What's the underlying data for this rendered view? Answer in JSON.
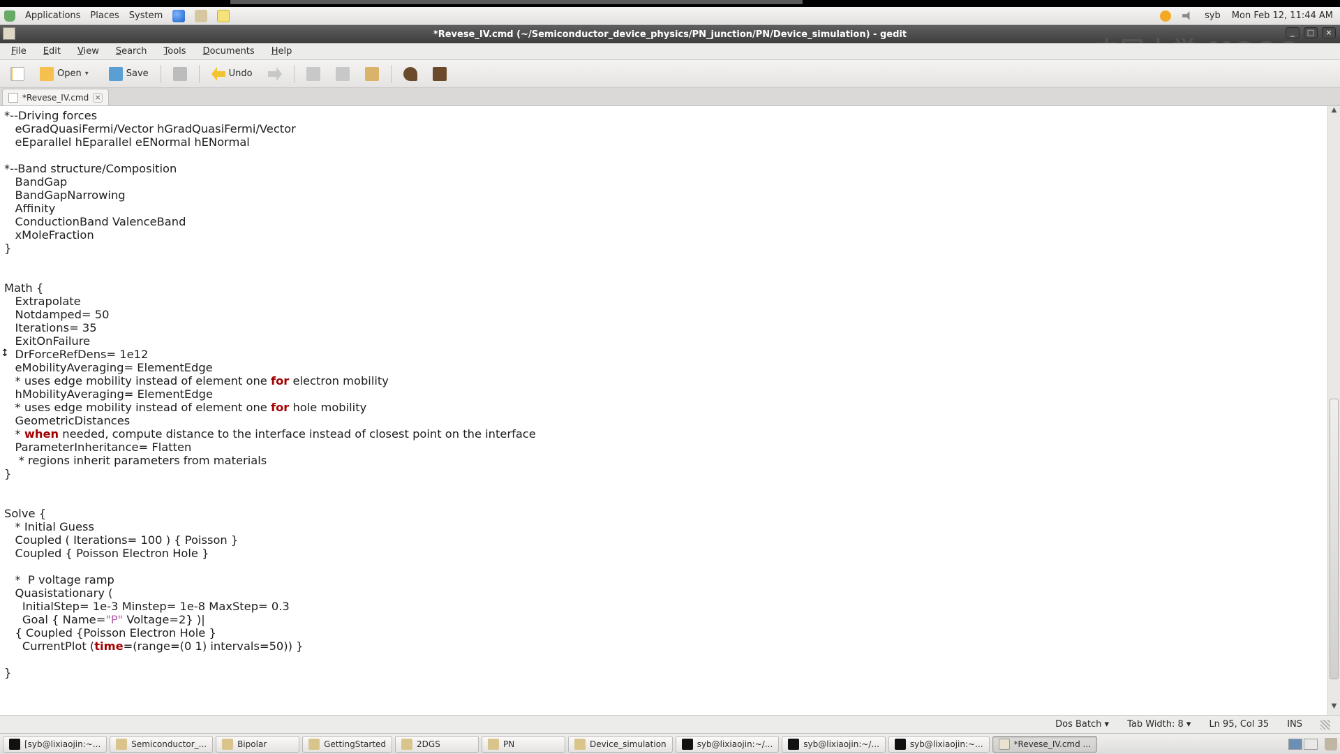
{
  "panel": {
    "menus": [
      "Applications",
      "Places",
      "System"
    ],
    "user": "syb",
    "clock": "Mon Feb 12, 11:44 AM"
  },
  "window": {
    "title": "*Revese_IV.cmd (~/Semiconductor_device_physics/PN_junction/PN/Device_simulation) - gedit",
    "min": "_",
    "max": "□",
    "close": "×"
  },
  "menubar": [
    "File",
    "Edit",
    "View",
    "Search",
    "Tools",
    "Documents",
    "Help"
  ],
  "toolbar": {
    "open": "Open",
    "save": "Save",
    "undo": "Undo"
  },
  "tab": {
    "name": "*Revese_IV.cmd",
    "close": "×"
  },
  "watermark": "中国大学 MOOC",
  "status": {
    "lang": "Dos Batch",
    "lang_arrow": "▾",
    "tabw": "Tab Width: 8",
    "tabw_arrow": "▾",
    "pos": "Ln 95, Col 35",
    "ins": "INS"
  },
  "taskbar": [
    {
      "label": "[syb@lixiaojin:~...",
      "icon": "term",
      "active": false
    },
    {
      "label": "Semiconductor_...",
      "icon": "fm",
      "active": false
    },
    {
      "label": "Bipolar",
      "icon": "fm",
      "active": false
    },
    {
      "label": "GettingStarted",
      "icon": "fm",
      "active": false
    },
    {
      "label": "2DGS",
      "icon": "fm",
      "active": false
    },
    {
      "label": "PN",
      "icon": "fm",
      "active": false
    },
    {
      "label": "Device_simulation",
      "icon": "fm",
      "active": false
    },
    {
      "label": "syb@lixiaojin:~/...",
      "icon": "term",
      "active": false
    },
    {
      "label": "syb@lixiaojin:~/...",
      "icon": "term",
      "active": false
    },
    {
      "label": "syb@lixiaojin:~...",
      "icon": "term",
      "active": false
    },
    {
      "label": "*Revese_IV.cmd ...",
      "icon": "gedit",
      "active": true
    }
  ],
  "code": {
    "l1": "*--Driving forces",
    "l2": "   eGradQuasiFermi/Vector hGradQuasiFermi/Vector",
    "l3": "   eEparallel hEparallel eENormal hENormal",
    "l4": "",
    "l5": "*--Band structure/Composition",
    "l6": "   BandGap",
    "l7": "   BandGapNarrowing",
    "l8": "   Affinity",
    "l9": "   ConductionBand ValenceBand",
    "l10": "   xMoleFraction",
    "l11": "}",
    "l12": "",
    "l13": "",
    "l14": "Math {",
    "l15": "   Extrapolate",
    "l16": "   Notdamped= 50",
    "l17": "   Iterations= 35",
    "l18": "   ExitOnFailure",
    "l19": "   DrForceRefDens= 1e12",
    "l20": "   eMobilityAveraging= ElementEdge",
    "l21a": "   * uses edge mobility instead of element one ",
    "l21b": " electron mobility",
    "l22": "   hMobilityAveraging= ElementEdge",
    "l23a": "   * uses edge mobility instead of element one ",
    "l23b": " hole mobility",
    "l24": "   GeometricDistances",
    "l25a": "   * ",
    "l25b": " needed, compute distance to the interface instead of closest point on the interface",
    "l26": "   ParameterInheritance= Flatten",
    "l27": "    * regions inherit parameters from materials",
    "l28": "}",
    "l29": "",
    "l30": "",
    "l31": "Solve {",
    "l32": "   * Initial Guess",
    "l33": "   Coupled ( Iterations= 100 ) { Poisson }",
    "l34": "   Coupled { Poisson Electron Hole }",
    "l35": "",
    "l36": "   *  P voltage ramp",
    "l37": "   Quasistationary (",
    "l38": "     InitialStep= 1e-3 Minstep= 1e-8 MaxStep= 0.3",
    "l39a": "     Goal { Name=",
    "l39b": " Voltage=2} )|",
    "l40": "   { Coupled {Poisson Electron Hole }",
    "l41a": "     CurrentPlot (",
    "l41b": "=(range=(0 1) intervals=50)) }",
    "l42": "",
    "l43": "}",
    "kw_for": "for",
    "kw_when": "when",
    "kw_time": "time",
    "str_p": "\"P\""
  }
}
